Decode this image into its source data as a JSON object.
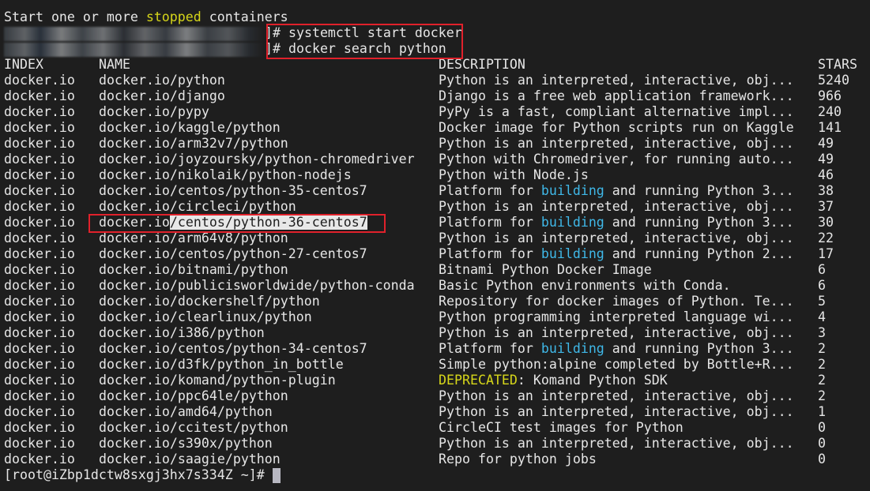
{
  "terminal": {
    "intro_line": {
      "pre": "Start one or more ",
      "highlight": "stopped",
      "post": " containers"
    },
    "commands": [
      {
        "prompt_suffix": "]# ",
        "command": "systemctl start docker"
      },
      {
        "prompt_suffix": "]# ",
        "command": "docker search python"
      }
    ],
    "headers": {
      "index": "INDEX",
      "name": "NAME",
      "description": "DESCRIPTION",
      "stars": "STARS"
    },
    "rows": [
      {
        "index": "docker.io",
        "name": "docker.io/python",
        "desc": [
          {
            "t": "Python is an interpreted, interactive, obj..."
          }
        ],
        "stars": "5240"
      },
      {
        "index": "docker.io",
        "name": "docker.io/django",
        "desc": [
          {
            "t": "Django is a free web application framework..."
          }
        ],
        "stars": "966"
      },
      {
        "index": "docker.io",
        "name": "docker.io/pypy",
        "desc": [
          {
            "t": "PyPy is a fast, compliant alternative impl..."
          }
        ],
        "stars": "240"
      },
      {
        "index": "docker.io",
        "name": "docker.io/kaggle/python",
        "desc": [
          {
            "t": "Docker image for Python scripts run on Kaggle"
          }
        ],
        "stars": "141"
      },
      {
        "index": "docker.io",
        "name": "docker.io/arm32v7/python",
        "desc": [
          {
            "t": "Python is an interpreted, interactive, obj..."
          }
        ],
        "stars": "49"
      },
      {
        "index": "docker.io",
        "name": "docker.io/joyzoursky/python-chromedriver",
        "desc": [
          {
            "t": "Python with Chromedriver, for running auto..."
          }
        ],
        "stars": "49"
      },
      {
        "index": "docker.io",
        "name": "docker.io/nikolaik/python-nodejs",
        "desc": [
          {
            "t": "Python with Node.js"
          }
        ],
        "stars": "46"
      },
      {
        "index": "docker.io",
        "name": "docker.io/centos/python-35-centos7",
        "desc": [
          {
            "t": "Platform for "
          },
          {
            "t": "building",
            "c": "cyan"
          },
          {
            "t": " and running Python 3..."
          }
        ],
        "stars": "38"
      },
      {
        "index": "docker.io",
        "name": "docker.io/circleci/python",
        "desc": [
          {
            "t": "Python is an interpreted, interactive, obj..."
          }
        ],
        "stars": "37"
      },
      {
        "index": "docker.io",
        "name": "docker.io/centos/python-36-centos7",
        "name_pre": "docker.io",
        "name_sel": "/centos/python-36-centos7",
        "desc": [
          {
            "t": "Platform for "
          },
          {
            "t": "building",
            "c": "cyan"
          },
          {
            "t": " and running Python 3..."
          }
        ],
        "stars": "30"
      },
      {
        "index": "docker.io",
        "name": "docker.io/arm64v8/python",
        "desc": [
          {
            "t": "Python is an interpreted, interactive, obj..."
          }
        ],
        "stars": "22"
      },
      {
        "index": "docker.io",
        "name": "docker.io/centos/python-27-centos7",
        "desc": [
          {
            "t": "Platform for "
          },
          {
            "t": "building",
            "c": "cyan"
          },
          {
            "t": " and running Python 2..."
          }
        ],
        "stars": "17"
      },
      {
        "index": "docker.io",
        "name": "docker.io/bitnami/python",
        "desc": [
          {
            "t": "Bitnami Python Docker Image"
          }
        ],
        "stars": "6"
      },
      {
        "index": "docker.io",
        "name": "docker.io/publicisworldwide/python-conda",
        "desc": [
          {
            "t": "Basic Python environments with Conda."
          }
        ],
        "stars": "6"
      },
      {
        "index": "docker.io",
        "name": "docker.io/dockershelf/python",
        "desc": [
          {
            "t": "Repository for docker images of Python. Te..."
          }
        ],
        "stars": "5"
      },
      {
        "index": "docker.io",
        "name": "docker.io/clearlinux/python",
        "desc": [
          {
            "t": "Python programming interpreted language wi..."
          }
        ],
        "stars": "4"
      },
      {
        "index": "docker.io",
        "name": "docker.io/i386/python",
        "desc": [
          {
            "t": "Python is an interpreted, interactive, obj..."
          }
        ],
        "stars": "3"
      },
      {
        "index": "docker.io",
        "name": "docker.io/centos/python-34-centos7",
        "desc": [
          {
            "t": "Platform for "
          },
          {
            "t": "building",
            "c": "cyan"
          },
          {
            "t": " and running Python 3..."
          }
        ],
        "stars": "2"
      },
      {
        "index": "docker.io",
        "name": "docker.io/d3fk/python_in_bottle",
        "desc": [
          {
            "t": "Simple python:alpine completed by Bottle+R..."
          }
        ],
        "stars": "2"
      },
      {
        "index": "docker.io",
        "name": "docker.io/komand/python-plugin",
        "desc": [
          {
            "t": "DEPRECATED",
            "c": "yellow"
          },
          {
            "t": ": Komand Python SDK"
          }
        ],
        "stars": "2"
      },
      {
        "index": "docker.io",
        "name": "docker.io/ppc64le/python",
        "desc": [
          {
            "t": "Python is an interpreted, interactive, obj..."
          }
        ],
        "stars": "2"
      },
      {
        "index": "docker.io",
        "name": "docker.io/amd64/python",
        "desc": [
          {
            "t": "Python is an interpreted, interactive, obj..."
          }
        ],
        "stars": "1"
      },
      {
        "index": "docker.io",
        "name": "docker.io/ccitest/python",
        "desc": [
          {
            "t": "CircleCI test images for Python"
          }
        ],
        "stars": "0"
      },
      {
        "index": "docker.io",
        "name": "docker.io/s390x/python",
        "desc": [
          {
            "t": "Python is an interpreted, interactive, obj..."
          }
        ],
        "stars": "0"
      },
      {
        "index": "docker.io",
        "name": "docker.io/saagie/python",
        "desc": [
          {
            "t": "Repo for python jobs"
          }
        ],
        "stars": "0"
      }
    ],
    "final_prompt": "[root@iZbp1dctw8sxgj3hx7s334Z ~]# ",
    "colors": {
      "background": "#1e1e1e",
      "text": "#e6e6e6",
      "yellow": "#d6d61a",
      "cyan": "#3fb8e8",
      "annotation_box": "#e0212b"
    }
  }
}
